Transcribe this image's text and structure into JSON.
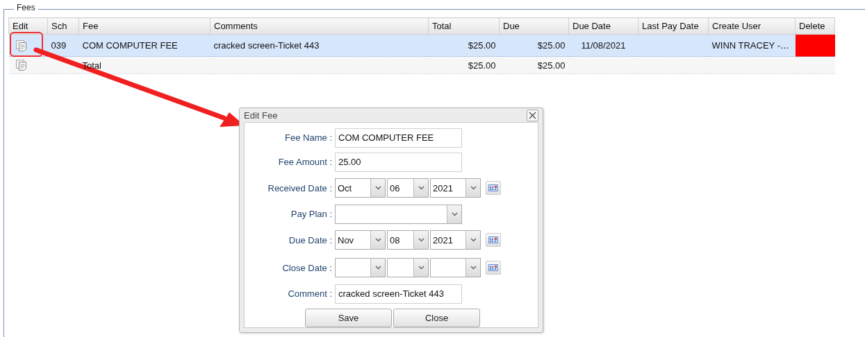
{
  "section": {
    "legend": "Fees"
  },
  "table": {
    "columns": [
      "Edit",
      "Sch",
      "Fee",
      "Comments",
      "Total",
      "Due",
      "Due Date",
      "Last Pay Date",
      "Create User",
      "Delete"
    ],
    "rows": [
      {
        "selected": true,
        "delete_flagged": true,
        "sch": "039",
        "fee": "COM COMPUTER FEE",
        "comments": "cracked screen-Ticket 443",
        "total": "$25.00",
        "due": "$25.00",
        "due_date": "11/08/2021",
        "create_user": "WINN TRACEY -…"
      },
      {
        "selected": false,
        "delete_flagged": false,
        "fee": "Total",
        "total": "$25.00",
        "due": "$25.00"
      }
    ]
  },
  "dialog": {
    "title": "Edit Fee",
    "fields": [
      {
        "kind": "text",
        "label": "Fee Name :",
        "value": "COM COMPUTER FEE"
      },
      {
        "kind": "text",
        "label": "Fee Amount :",
        "value": "25.00"
      },
      {
        "kind": "date",
        "label": "Received Date :",
        "month": "Oct",
        "day": "06",
        "year": "2021"
      },
      {
        "kind": "select",
        "label": "Pay Plan :"
      },
      {
        "kind": "date",
        "label": "Due Date :",
        "month": "Nov",
        "day": "08",
        "year": "2021"
      },
      {
        "kind": "date",
        "label": "Close Date :"
      },
      {
        "kind": "text",
        "label": "Comment :",
        "value": "cracked screen-Ticket 443"
      }
    ],
    "buttons": [
      "Save",
      "Close"
    ]
  }
}
